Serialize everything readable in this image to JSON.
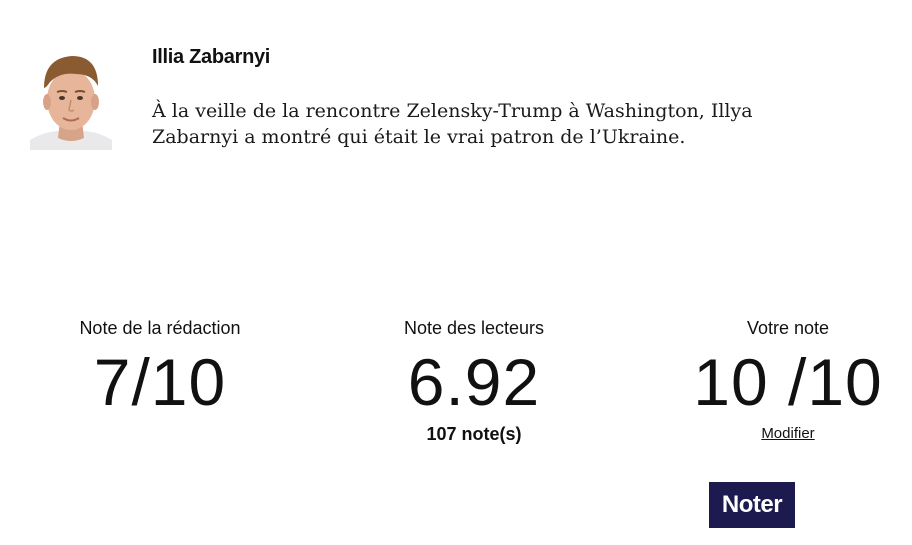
{
  "player": {
    "name": "Illia Zabarnyi",
    "comment": "À la veille de la rencontre Zelensky-Trump à Washington, Illya Zabarnyi a montré qui était le vrai patron de l’Ukraine.",
    "photo_icon": "player-portrait"
  },
  "ratings": {
    "redaction": {
      "label": "Note de la rédaction",
      "value": "7/10"
    },
    "lecteurs": {
      "label": "Note des lecteurs",
      "value": "6.92",
      "count_text": "107 note(s)"
    },
    "votre": {
      "label": "Votre note",
      "value": "10 /10",
      "modify_label": "Modifier"
    }
  },
  "actions": {
    "rate_label": "Noter"
  },
  "colors": {
    "button_bg": "#1c1a4e",
    "button_text": "#ffffff",
    "text": "#111111"
  }
}
